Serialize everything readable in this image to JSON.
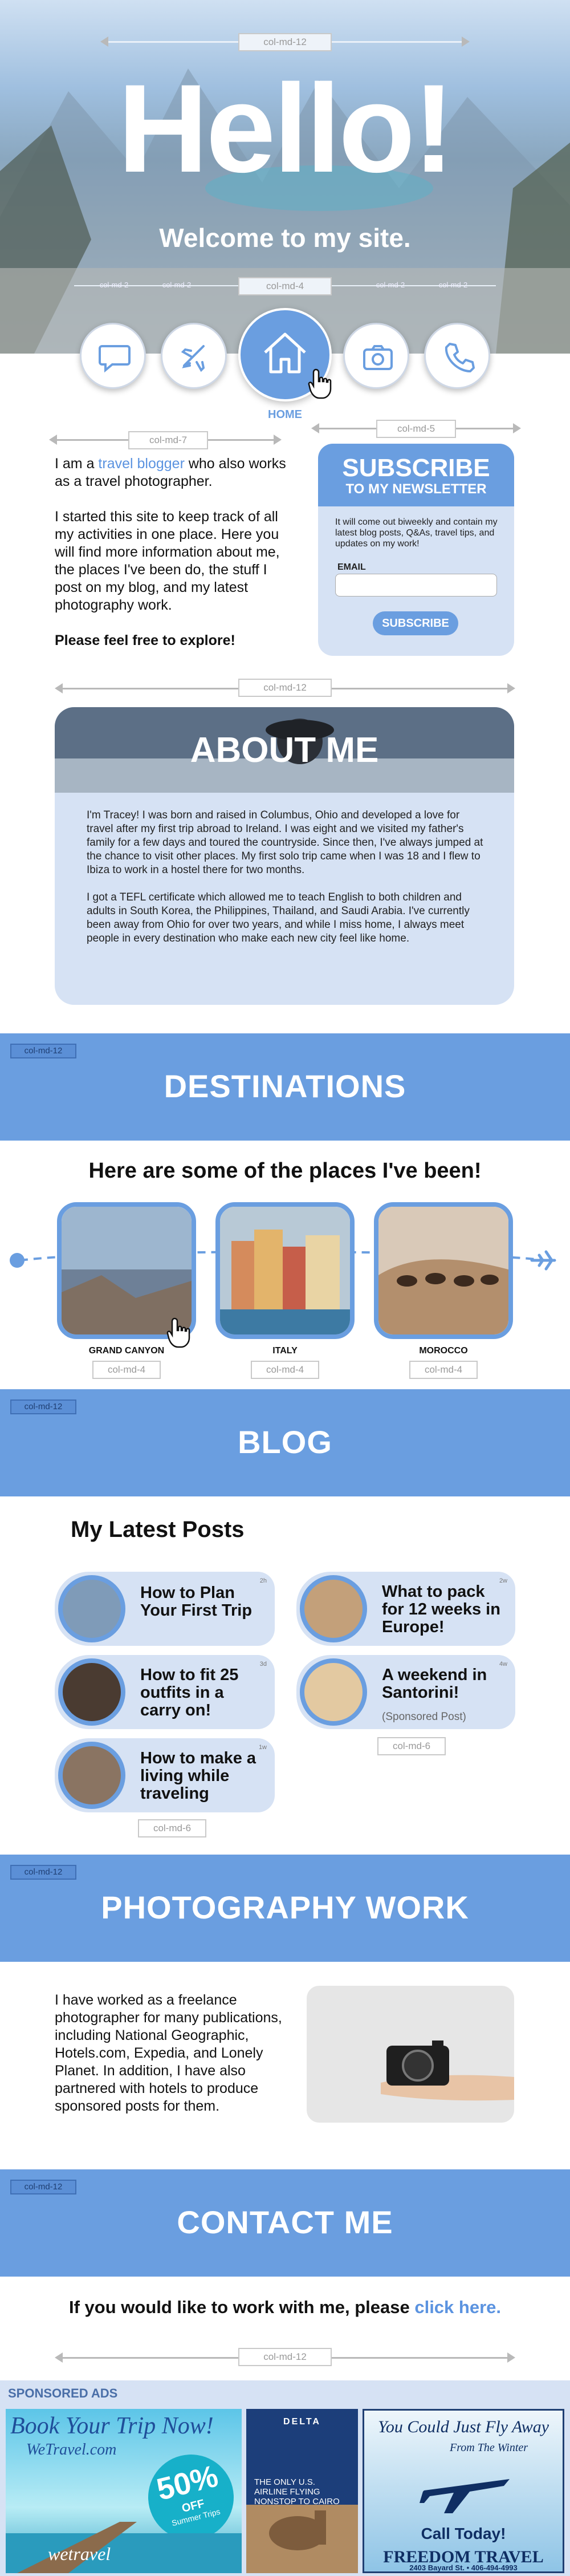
{
  "hero": {
    "title": "Hello!",
    "subtitle": "Welcome to my site.",
    "grid_top": "col-md-12",
    "grid_mid": "col-md-4",
    "grid_small": "col-md-2"
  },
  "nav": {
    "items": [
      {
        "name": "chat",
        "icon": "chat-icon"
      },
      {
        "name": "travel",
        "icon": "airplane-icon"
      },
      {
        "name": "home",
        "icon": "home-icon",
        "label": "HOME"
      },
      {
        "name": "photography",
        "icon": "camera-icon"
      },
      {
        "name": "contact",
        "icon": "phone-icon"
      }
    ],
    "home_label": "HOME"
  },
  "intro": {
    "grid_left": "col-md-7",
    "grid_right": "col-md-5",
    "line1_pre": "I am a ",
    "line1_link": "travel blogger",
    "line1_post": " who also works as a travel photographer.",
    "para2": "I started this site to keep track of all my activities in one place. Here you will find more information about me, the places I've been do, the stuff I post on my blog, and my latest photography work.",
    "para3": "Please feel free to explore!"
  },
  "newsletter": {
    "title": "SUBSCRIBE",
    "subtitle": "TO MY NEWSLETTER",
    "body": "It will come out biweekly and contain my latest blog posts, Q&As, travel tips, and updates on my work!",
    "email_label": "EMAIL",
    "email_placeholder": "",
    "button": "SUBSCRIBE"
  },
  "about": {
    "grid": "col-md-12",
    "title": "ABOUT ME",
    "p1": "I'm Tracey! I was born and raised in Columbus, Ohio and developed a love for travel after my first trip abroad to Ireland. I was eight and we visited my father's family for a few days and toured the countryside. Since then, I've always jumped at the chance to visit other places. My first solo trip came when I was 18 and I flew to Ibiza to work in a hostel there for two months.",
    "p2": "I got a TEFL certificate which allowed me to teach English to both children and adults in South Korea, the Philippines, Thailand, and Saudi Arabia. I've currently been away from Ohio for over two years, and while I miss home, I always meet people in every destination who make each new city feel like home."
  },
  "destinations": {
    "grid": "col-md-12",
    "title": "DESTINATIONS",
    "heading": "Here are some of the places I've been!",
    "items": [
      {
        "label": "GRAND CANYON",
        "grid": "col-md-4"
      },
      {
        "label": "ITALY",
        "grid": "col-md-4"
      },
      {
        "label": "MOROCCO",
        "grid": "col-md-4"
      }
    ]
  },
  "blog": {
    "grid": "col-md-12",
    "title": "BLOG",
    "heading": "My Latest Posts",
    "posts": [
      {
        "title": "How to Plan Your First Trip",
        "time": "2h",
        "sub": ""
      },
      {
        "title": "What to pack for 12 weeks in Europe!",
        "time": "2w",
        "sub": ""
      },
      {
        "title": "How to fit 25 outfits in a carry on!",
        "time": "3d",
        "sub": ""
      },
      {
        "title": "A weekend in Santorini!",
        "time": "4w",
        "sub": "(Sponsored Post)"
      },
      {
        "title": "How to make a living while traveling",
        "time": "1w",
        "sub": ""
      }
    ],
    "grid_left": "col-md-6",
    "grid_right": "col-md-6"
  },
  "photography": {
    "grid": "col-md-12",
    "title": "PHOTOGRAPHY WORK",
    "body": "I have worked as a freelance photographer for many publications, including National Geographic, Hotels.com, Expedia, and Lonely Planet. In addition, I have also partnered with hotels to produce sponsored posts for them."
  },
  "contact": {
    "grid": "col-md-12",
    "title": "CONTACT ME",
    "line_pre": "If you would like to work with me, please ",
    "line_link": "click here.",
    "grid_bottom": "col-md-12"
  },
  "ads": {
    "label": "SPONSORED ADS",
    "ad1_title": "Book Your Trip Now!",
    "ad1_url": "WeTravel.com",
    "ad1_pct": "50%",
    "ad1_off": "OFF",
    "ad1_tag": "Summer Trips",
    "ad1_brand": "wetravel",
    "ad2_brand": "DELTA",
    "ad2_text": "THE ONLY U.S. AIRLINE FLYING NONSTOP TO CAIRO",
    "ad3_title": "You Could Just Fly Away",
    "ad3_sub": "From The Winter",
    "ad3_call": "Call Today!",
    "ad3_brand": "FREEDOM TRAVEL",
    "ad3_addr": "2403 Bayard St. • 406-494-4993"
  },
  "colors": {
    "accent": "#6a9ee0",
    "light": "#d6e2f4",
    "link": "#5b93e0"
  }
}
